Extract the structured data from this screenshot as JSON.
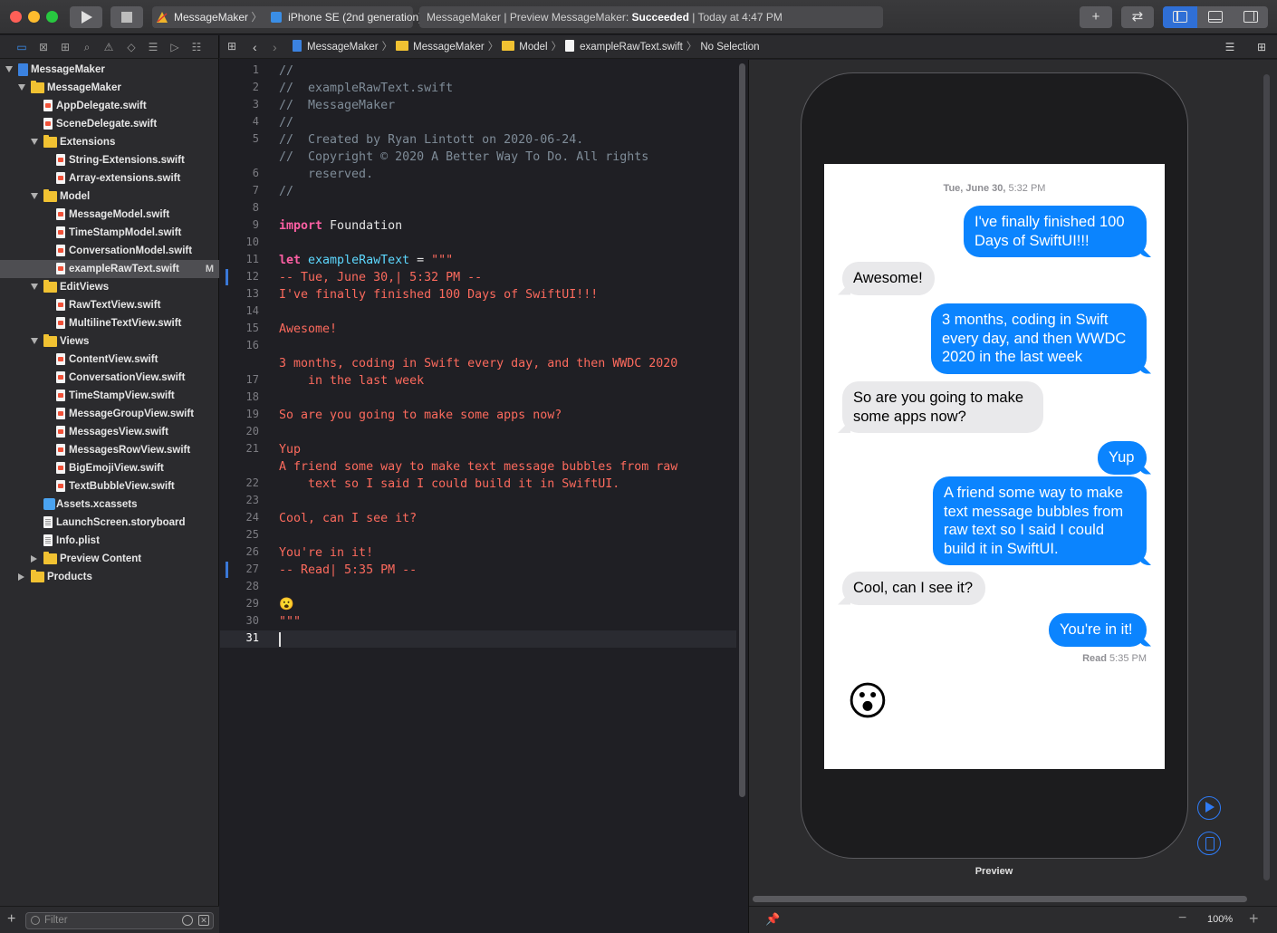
{
  "toolbar": {
    "scheme_app": "MessageMaker",
    "scheme_device": "iPhone SE (2nd generation)",
    "status_prefix": "MessageMaker | Preview MessageMaker: ",
    "status_result": "Succeeded",
    "status_suffix": " | Today at 4:47 PM",
    "add_label": "+",
    "swap_label": "⇄"
  },
  "navigator": {
    "filter_placeholder": "Filter",
    "add_label": "+",
    "tree": [
      {
        "label": "MessageMaker",
        "kind": "project",
        "level": 0,
        "disclosure": "open"
      },
      {
        "label": "MessageMaker",
        "kind": "folder",
        "level": 1,
        "disclosure": "open"
      },
      {
        "label": "AppDelegate.swift",
        "kind": "swift",
        "level": 2
      },
      {
        "label": "SceneDelegate.swift",
        "kind": "swift",
        "level": 2
      },
      {
        "label": "Extensions",
        "kind": "folder",
        "level": 2,
        "disclosure": "open"
      },
      {
        "label": "String-Extensions.swift",
        "kind": "swift",
        "level": 3
      },
      {
        "label": "Array-extensions.swift",
        "kind": "swift",
        "level": 3
      },
      {
        "label": "Model",
        "kind": "folder",
        "level": 2,
        "disclosure": "open"
      },
      {
        "label": "MessageModel.swift",
        "kind": "swift",
        "level": 3
      },
      {
        "label": "TimeStampModel.swift",
        "kind": "swift",
        "level": 3
      },
      {
        "label": "ConversationModel.swift",
        "kind": "swift",
        "level": 3
      },
      {
        "label": "exampleRawText.swift",
        "kind": "swift",
        "level": 3,
        "selected": true,
        "badge": "M"
      },
      {
        "label": "EditViews",
        "kind": "folder",
        "level": 2,
        "disclosure": "open"
      },
      {
        "label": "RawTextView.swift",
        "kind": "swift",
        "level": 3
      },
      {
        "label": "MultilineTextView.swift",
        "kind": "swift",
        "level": 3
      },
      {
        "label": "Views",
        "kind": "folder",
        "level": 2,
        "disclosure": "open"
      },
      {
        "label": "ContentView.swift",
        "kind": "swift",
        "level": 3
      },
      {
        "label": "ConversationView.swift",
        "kind": "swift",
        "level": 3
      },
      {
        "label": "TimeStampView.swift",
        "kind": "swift",
        "level": 3
      },
      {
        "label": "MessageGroupView.swift",
        "kind": "swift",
        "level": 3
      },
      {
        "label": "MessagesView.swift",
        "kind": "swift",
        "level": 3
      },
      {
        "label": "MessagesRowView.swift",
        "kind": "swift",
        "level": 3
      },
      {
        "label": "BigEmojiView.swift",
        "kind": "swift",
        "level": 3
      },
      {
        "label": "TextBubbleView.swift",
        "kind": "swift",
        "level": 3
      },
      {
        "label": "Assets.xcassets",
        "kind": "assets",
        "level": 2
      },
      {
        "label": "LaunchScreen.storyboard",
        "kind": "plain",
        "level": 2
      },
      {
        "label": "Info.plist",
        "kind": "plain",
        "level": 2
      },
      {
        "label": "Preview Content",
        "kind": "folder",
        "level": 2,
        "disclosure": "closed"
      },
      {
        "label": "Products",
        "kind": "folder",
        "level": 1,
        "disclosure": "closed"
      }
    ]
  },
  "jumpbar": {
    "crumbs": [
      "MessageMaker",
      "MessageMaker",
      "Model",
      "exampleRawText.swift",
      "No Selection"
    ]
  },
  "editor": {
    "lines": [
      {
        "n": "1",
        "text": "//",
        "style": "comment"
      },
      {
        "n": "2",
        "text": "//  exampleRawText.swift",
        "style": "comment"
      },
      {
        "n": "3",
        "text": "//  MessageMaker",
        "style": "comment"
      },
      {
        "n": "4",
        "text": "//",
        "style": "comment"
      },
      {
        "n": "5",
        "text": "//  Created by Ryan Lintott on 2020-06-24.",
        "style": "comment"
      },
      {
        "n": "6",
        "text": "//  Copyright © 2020 A Better Way To Do. All rights",
        "cont": "    reserved.",
        "style": "comment"
      },
      {
        "n": "7",
        "text": "//",
        "style": "comment"
      },
      {
        "n": "8",
        "text": "",
        "style": "string"
      },
      {
        "n": "9",
        "kw": "import",
        "rest": " Foundation",
        "style": "import"
      },
      {
        "n": "10",
        "text": "",
        "style": "string"
      },
      {
        "n": "11",
        "kw": "let",
        "ident": " exampleRawText",
        "rest": " = ",
        "str": "\"\"\"",
        "style": "let"
      },
      {
        "n": "12",
        "text": "-- Tue, June 30,| 5:32 PM --",
        "style": "string",
        "changed": true
      },
      {
        "n": "13",
        "text": "I've finally finished 100 Days of SwiftUI!!!",
        "style": "string"
      },
      {
        "n": "14",
        "text": "",
        "style": "string"
      },
      {
        "n": "15",
        "text": "Awesome!",
        "style": "string"
      },
      {
        "n": "16",
        "text": "",
        "style": "string"
      },
      {
        "n": "17",
        "text": "3 months, coding in Swift every day, and then WWDC 2020",
        "cont": "    in the last week",
        "style": "string"
      },
      {
        "n": "18",
        "text": "",
        "style": "string"
      },
      {
        "n": "19",
        "text": "So are you going to make some apps now?",
        "style": "string"
      },
      {
        "n": "20",
        "text": "",
        "style": "string"
      },
      {
        "n": "21",
        "text": "Yup",
        "style": "string"
      },
      {
        "n": "22",
        "text": "A friend some way to make text message bubbles from raw",
        "cont": "    text so I said I could build it in SwiftUI.",
        "style": "string"
      },
      {
        "n": "23",
        "text": "",
        "style": "string"
      },
      {
        "n": "24",
        "text": "Cool, can I see it?",
        "style": "string"
      },
      {
        "n": "25",
        "text": "",
        "style": "string"
      },
      {
        "n": "26",
        "text": "You're in it!",
        "style": "string"
      },
      {
        "n": "27",
        "text": "-- Read| 5:35 PM --",
        "style": "string",
        "changed": true
      },
      {
        "n": "28",
        "text": "",
        "style": "string"
      },
      {
        "n": "29",
        "text": "😮",
        "style": "string"
      },
      {
        "n": "30",
        "text": "\"\"\"",
        "style": "string"
      },
      {
        "n": "31",
        "text": "",
        "style": "string",
        "current": true
      }
    ]
  },
  "preview": {
    "label": "Preview",
    "zoom": "100%",
    "timestamp_day": "Tue, June 30,",
    "timestamp_time": " 5:32 PM",
    "messages": [
      {
        "from": "me",
        "text": "I've finally finished 100 Days of SwiftUI!!!"
      },
      {
        "from": "them",
        "text": "Awesome!"
      },
      {
        "from": "me",
        "text": "3 months, coding in Swift every day, and then WWDC 2020 in the last week"
      },
      {
        "from": "them",
        "text": "So are you going to make some apps now?"
      },
      {
        "from": "me",
        "text": "Yup"
      },
      {
        "from": "me",
        "text": "A friend some way to make text message bubbles from raw text so I said I could build it in SwiftUI."
      },
      {
        "from": "them",
        "text": "Cool, can I see it?"
      },
      {
        "from": "me",
        "text": "You're in it!"
      }
    ],
    "read_label": "Read",
    "read_time": " 5:35 PM",
    "emoji": "😮"
  }
}
